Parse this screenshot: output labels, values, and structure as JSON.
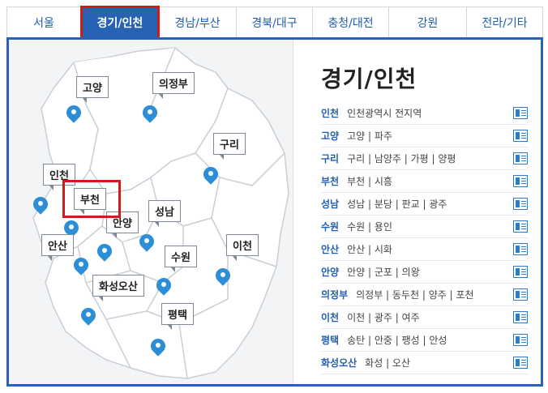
{
  "tabs": [
    {
      "label": "서울",
      "active": false
    },
    {
      "label": "경기/인천",
      "active": true
    },
    {
      "label": "경남/부산",
      "active": false
    },
    {
      "label": "경북/대구",
      "active": false
    },
    {
      "label": "충청/대전",
      "active": false
    },
    {
      "label": "강원",
      "active": false
    },
    {
      "label": "전라/기타",
      "active": false
    }
  ],
  "map": {
    "cities": [
      "고양",
      "의정부",
      "구리",
      "인천",
      "부천",
      "안양",
      "성남",
      "안산",
      "수원",
      "이천",
      "화성오산",
      "평택"
    ]
  },
  "panel": {
    "title": "경기/인천",
    "rows": [
      {
        "region": "인천",
        "items": "인천광역시 전지역",
        "doc": true
      },
      {
        "region": "고양",
        "items": "고양 | 파주",
        "doc": true
      },
      {
        "region": "구리",
        "items": "구리 | 남양주 | 가평 | 양평",
        "doc": true
      },
      {
        "region": "부천",
        "items": "부천 | 시흥",
        "doc": true
      },
      {
        "region": "성남",
        "items": "성남 | 분당 | 판교 | 광주",
        "doc": true
      },
      {
        "region": "수원",
        "items": "수원 | 용인",
        "doc": true
      },
      {
        "region": "안산",
        "items": "안산 | 시화",
        "doc": true
      },
      {
        "region": "안양",
        "items": "안양 | 군포 | 의왕",
        "doc": true
      },
      {
        "region": "의정부",
        "items": "의정부 | 동두천 | 양주 | 포천",
        "doc": true
      },
      {
        "region": "이천",
        "items": "이천 | 광주 | 여주",
        "doc": true
      },
      {
        "region": "평택",
        "items": "송탄 | 안중 | 팽성 | 안성",
        "doc": true
      },
      {
        "region": "화성오산",
        "items": "화성 | 오산",
        "doc": true
      }
    ]
  },
  "colors": {
    "accent": "#2762b3",
    "highlight": "#d11a1a",
    "pin": "#2d8ed8"
  }
}
